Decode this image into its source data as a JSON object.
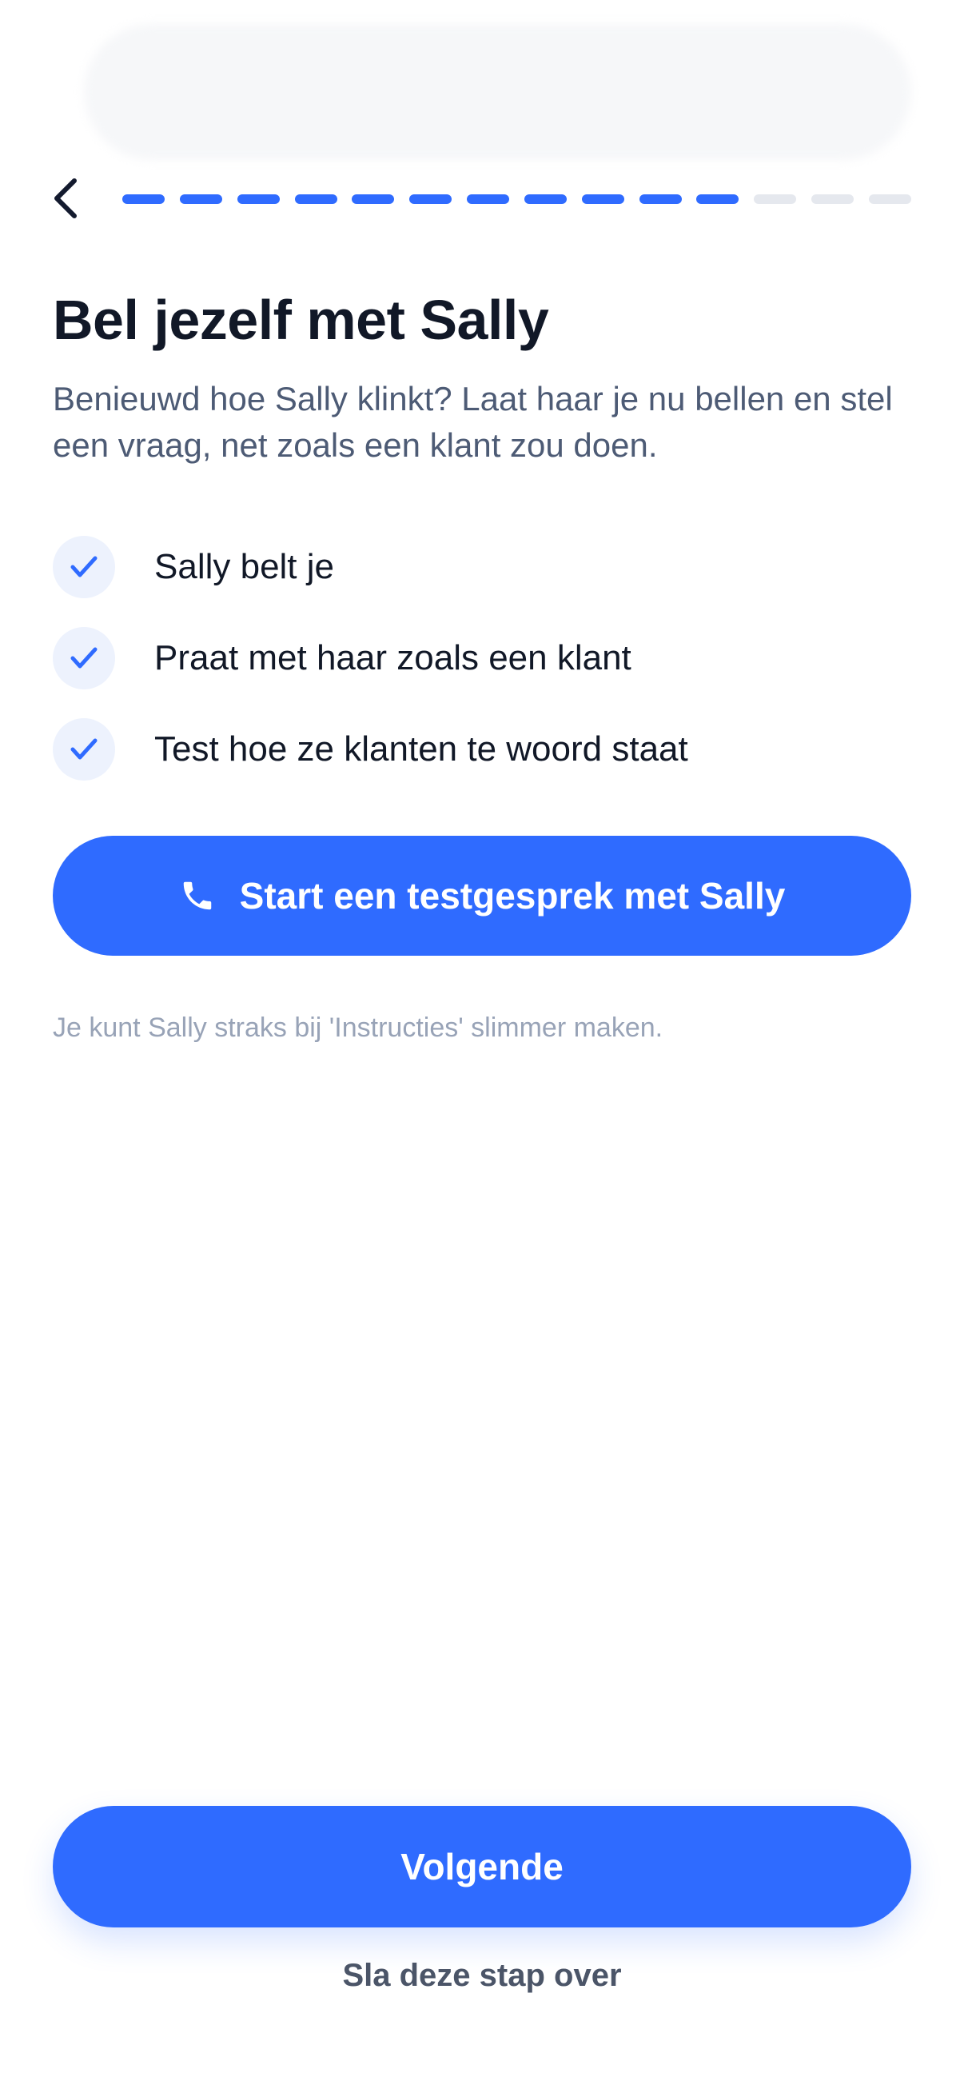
{
  "header": {
    "back_icon": "chevron-left-icon",
    "progress": {
      "total_steps": 14,
      "completed_steps": 11
    },
    "colors": {
      "active": "#2f6bff",
      "inactive": "#e5e8ee"
    }
  },
  "main": {
    "title": "Bel jezelf met Sally",
    "subtitle": "Benieuwd hoe Sally klinkt? Laat haar je nu bellen en stel een vraag, net zoals een klant zou doen.",
    "checklist": [
      {
        "icon": "checkmark-icon",
        "label": "Sally belt je"
      },
      {
        "icon": "checkmark-icon",
        "label": "Praat met haar zoals een klant"
      },
      {
        "icon": "checkmark-icon",
        "label": "Test hoe ze klanten te woord staat"
      }
    ],
    "call_button": {
      "icon": "phone-icon",
      "label": "Start een testgesprek met Sally"
    },
    "hint": "Je kunt Sally straks bij 'Instructies' slimmer maken."
  },
  "footer": {
    "next_label": "Volgende",
    "skip_label": "Sla deze stap over"
  },
  "colors": {
    "accent": "#2f6bff",
    "title": "#111827",
    "subtitle": "#4d5b75",
    "hint": "#98a3b7"
  }
}
